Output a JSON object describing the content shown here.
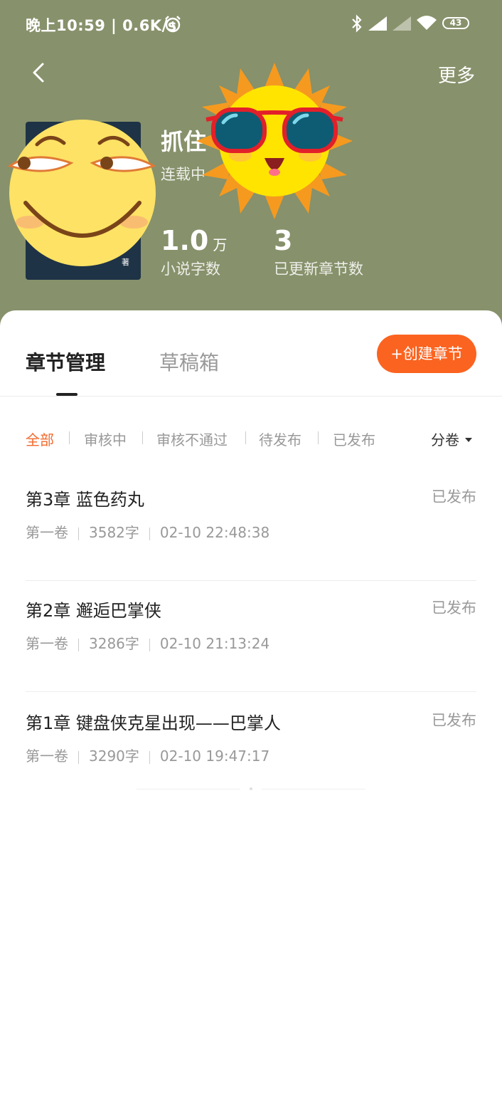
{
  "status_bar": {
    "time_text": "晚上10:59 | 0.6K/s",
    "battery": "43"
  },
  "nav": {
    "more_label": "更多"
  },
  "book": {
    "title": "抓住",
    "status": "连载中",
    "cover_author": "著",
    "word_count_value": "1.0",
    "word_count_unit": "万",
    "word_count_label": "小说字数",
    "chapters_count_value": "3",
    "chapters_count_label": "已更新章节数"
  },
  "tabs": [
    {
      "label": "章节管理"
    },
    {
      "label": "草稿箱"
    }
  ],
  "create_button": "+创建章节",
  "filters": [
    "全部",
    "审核中",
    "审核不通过",
    "待发布",
    "已发布"
  ],
  "volume_select": "分卷",
  "chapters": [
    {
      "title": "第3章 蓝色药丸",
      "status": "已发布",
      "volume": "第一卷",
      "words": "3582字",
      "time": "02-10 22:48:38"
    },
    {
      "title": "第2章 邂逅巴掌侠",
      "status": "已发布",
      "volume": "第一卷",
      "words": "3286字",
      "time": "02-10 21:13:24"
    },
    {
      "title": "第1章 键盘侠克星出现——巴掌人",
      "status": "已发布",
      "volume": "第一卷",
      "words": "3290字",
      "time": "02-10 19:47:17"
    }
  ],
  "colors": {
    "header_bg": "#87916b",
    "accent": "#fb6320"
  }
}
